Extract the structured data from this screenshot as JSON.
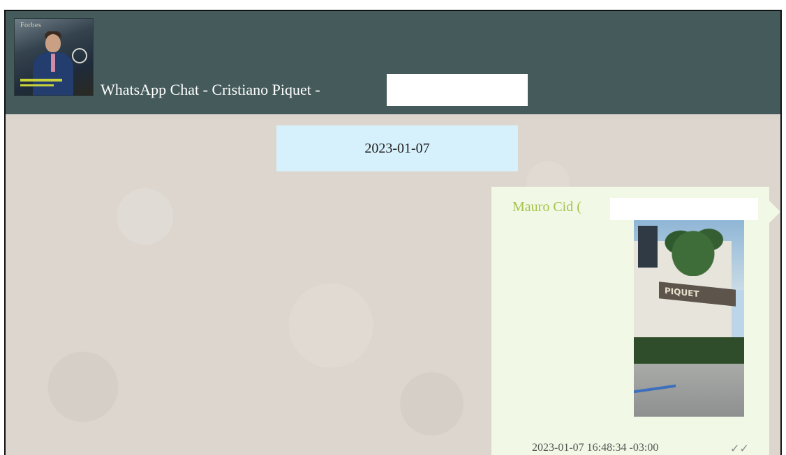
{
  "header": {
    "title": "WhatsApp Chat - Cristiano Piquet -",
    "avatar_icon": "contact-avatar-icon",
    "avatar_text": "Forbes"
  },
  "chat": {
    "date_chip": "2023-01-07",
    "messages": [
      {
        "sender": "Mauro Cid (",
        "attachment_icon": "image-attachment-icon",
        "photo_sign_text": "PIQUET",
        "timestamp": "2023-01-07 16:48:34 -03:00",
        "status_icon": "double-check-icon",
        "status_glyph": "✓✓"
      }
    ]
  },
  "colors": {
    "header_bg": "#455a5b",
    "chat_bg": "#dcd6ce",
    "date_chip_bg": "#d6f1fb",
    "bubble_bg": "#f1f8e6",
    "sender_color": "#a6c44e"
  }
}
